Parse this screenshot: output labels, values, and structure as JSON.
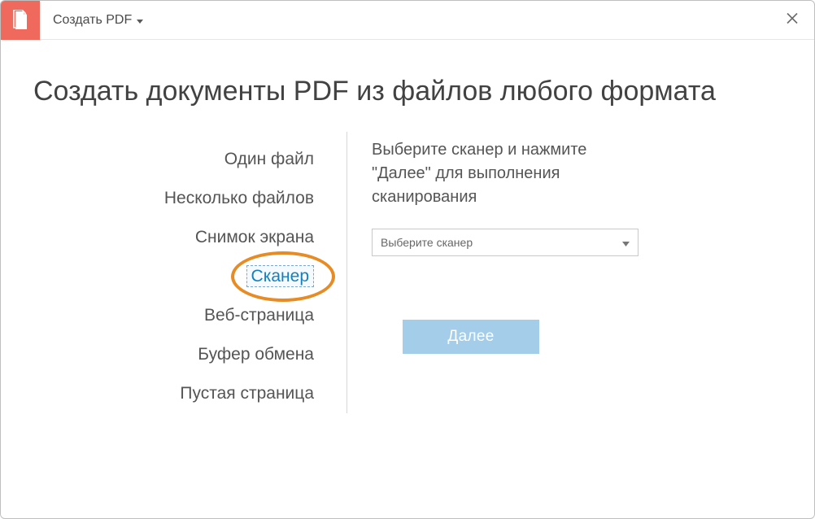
{
  "header": {
    "app_menu_label": "Создать PDF"
  },
  "page": {
    "heading": "Создать документы PDF из файлов любого формата"
  },
  "menu": {
    "items": [
      {
        "label": "Один файл",
        "selected": false
      },
      {
        "label": "Несколько файлов",
        "selected": false
      },
      {
        "label": "Снимок экрана",
        "selected": false
      },
      {
        "label": "Сканер",
        "selected": true
      },
      {
        "label": "Веб-страница",
        "selected": false
      },
      {
        "label": "Буфер обмена",
        "selected": false
      },
      {
        "label": "Пустая страница",
        "selected": false
      }
    ]
  },
  "panel": {
    "instructions": "Выберите сканер и нажмите \"Далее\" для выполнения сканирования",
    "scanner_select_placeholder": "Выберите сканер",
    "next_button_label": "Далее"
  },
  "colors": {
    "accent_red": "#ef6a5d",
    "link_blue": "#167fbd",
    "button_blue": "#a3cde9",
    "ring_orange": "#e78b24"
  }
}
